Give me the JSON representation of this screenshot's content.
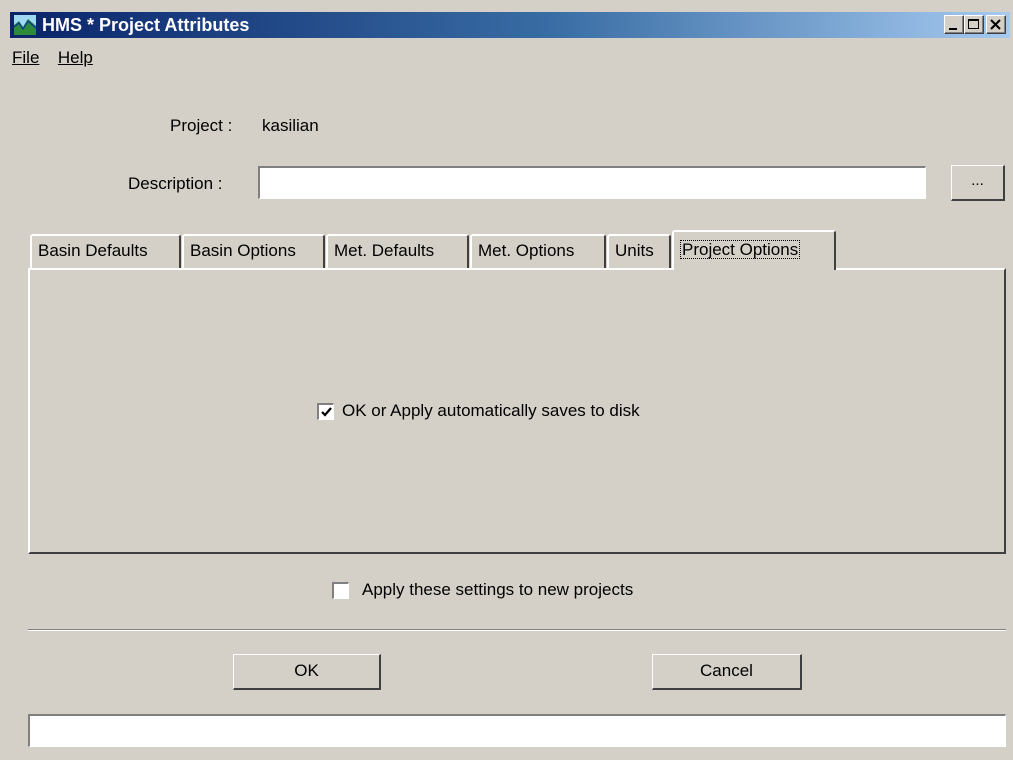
{
  "window": {
    "title": "HMS * Project Attributes",
    "icon": "hms-app-icon",
    "controls": [
      "minimize-icon",
      "maximize-icon",
      "close-icon"
    ]
  },
  "menu": {
    "file": "File",
    "help": "Help"
  },
  "project": {
    "label": "Project :",
    "value": "kasilian"
  },
  "description": {
    "label": "Description :",
    "value": "",
    "browse_label": "..."
  },
  "tabs": [
    {
      "label": "Basin Defaults",
      "active": false
    },
    {
      "label": "Basin Options",
      "active": false
    },
    {
      "label": "Met. Defaults",
      "active": false
    },
    {
      "label": "Met. Options",
      "active": false
    },
    {
      "label": "Units",
      "active": false
    },
    {
      "label": "Project Options",
      "active": true
    }
  ],
  "project_options": {
    "autosave_label": "OK or Apply automatically saves to disk",
    "autosave_checked": true
  },
  "apply_to_new": {
    "label": "Apply these settings to new projects",
    "checked": false
  },
  "buttons": {
    "ok": "OK",
    "cancel": "Cancel"
  },
  "status_text": "",
  "colors": {
    "face": "#d4d0c8",
    "title_start": "#0a246a",
    "title_end": "#a6caf0"
  }
}
